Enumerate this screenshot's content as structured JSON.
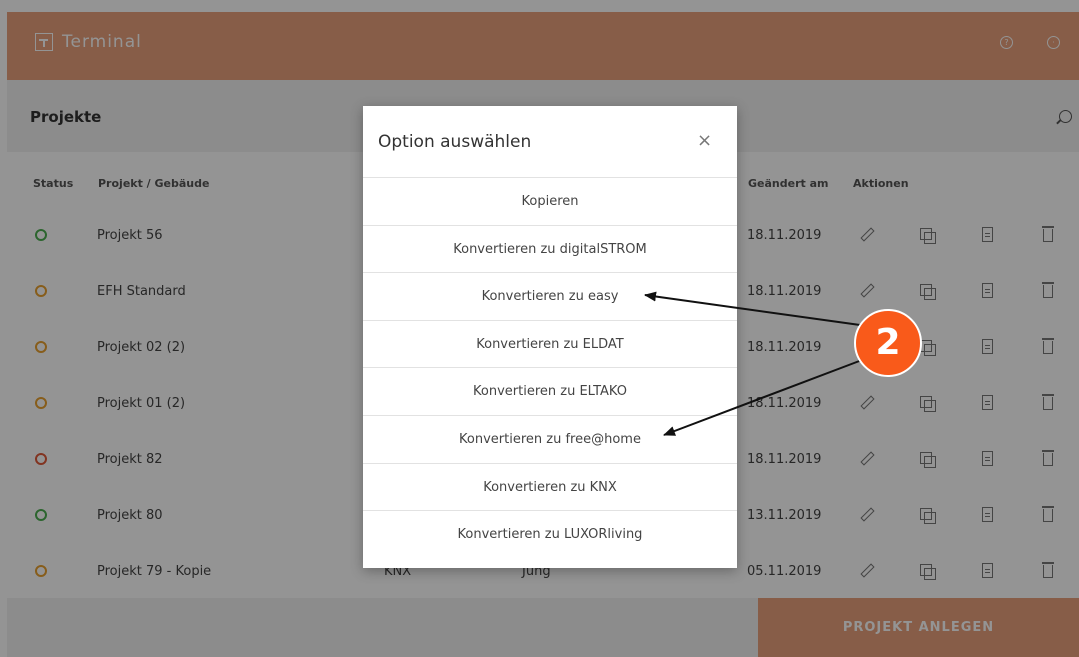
{
  "header": {
    "app_title": "Terminal",
    "help_icon": "help-icon",
    "settings_icon": "settings-icon",
    "accent": "#e8a07c"
  },
  "page": {
    "title": "Projekte",
    "search_icon": "search-icon"
  },
  "table": {
    "columns": [
      "Status",
      "Projekt / Gebäude",
      "Geändert am",
      "Aktionen"
    ],
    "rows": [
      {
        "status_color": "#4caf50",
        "name": "Projekt 56",
        "system": "",
        "manufacturer": "",
        "changed": "18.11.2019"
      },
      {
        "status_color": "#e8a030",
        "name": "EFH Standard",
        "system": "",
        "manufacturer": "",
        "changed": "18.11.2019"
      },
      {
        "status_color": "#e8a030",
        "name": "Projekt 02 (2)",
        "system": "",
        "manufacturer": "",
        "changed": "18.11.2019"
      },
      {
        "status_color": "#e8a030",
        "name": "Projekt 01 (2)",
        "system": "",
        "manufacturer": "",
        "changed": "18.11.2019"
      },
      {
        "status_color": "#e05a3a",
        "name": "Projekt 82",
        "system": "",
        "manufacturer": "",
        "changed": "18.11.2019"
      },
      {
        "status_color": "#4caf50",
        "name": "Projekt 80",
        "system": "",
        "manufacturer": "",
        "changed": "13.11.2019"
      },
      {
        "status_color": "#e8a030",
        "name": "Projekt 79 - Kopie",
        "system": "KNX",
        "manufacturer": "Jung",
        "changed": "05.11.2019"
      }
    ]
  },
  "footer": {
    "create_label": "PROJEKT ANLEGEN"
  },
  "modal": {
    "title": "Option auswählen",
    "close": "×",
    "options": [
      "Kopieren",
      "Konvertieren zu digitalSTROM",
      "Konvertieren zu easy",
      "Konvertieren zu ELDAT",
      "Konvertieren zu ELTAKO",
      "Konvertieren zu free@home",
      "Konvertieren zu KNX",
      "Konvertieren zu LUXORliving"
    ]
  },
  "annotation": {
    "badge": "2",
    "badge_color": "#f95a1a"
  }
}
